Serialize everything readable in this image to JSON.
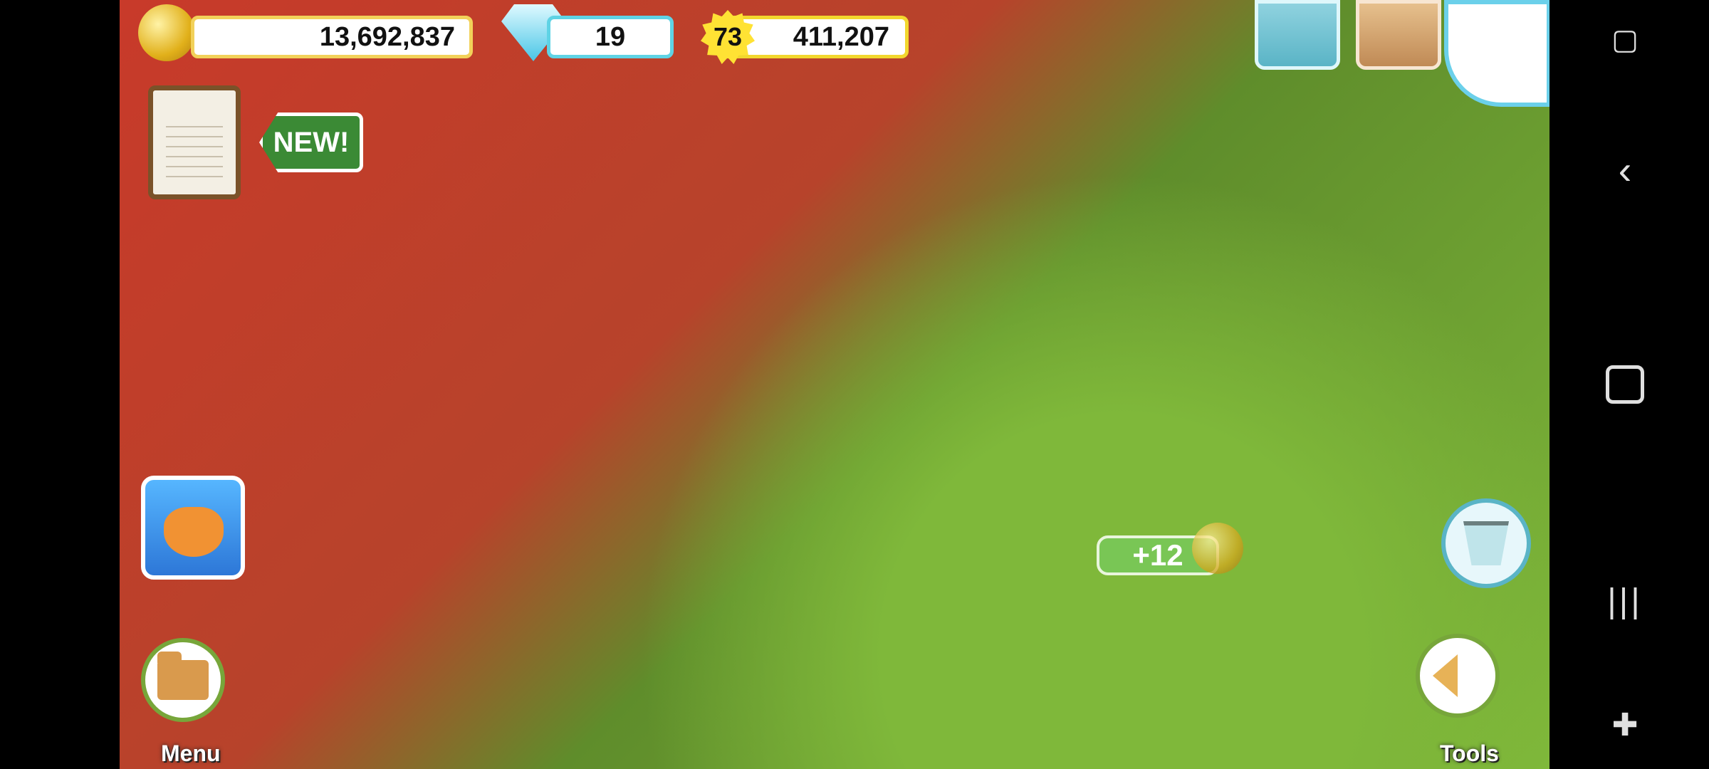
{
  "hud": {
    "coins": "13,692,837",
    "gems": "19",
    "level": "73",
    "xp": "411,207"
  },
  "badges": {
    "new": "NEW!"
  },
  "buttons": {
    "menu_label": "Menu",
    "tools_label": "Tools"
  },
  "reward": {
    "text": "+12"
  },
  "nav": {
    "back_glyph": "‹",
    "recents_glyph": "|||",
    "game_glyph": "✚"
  }
}
